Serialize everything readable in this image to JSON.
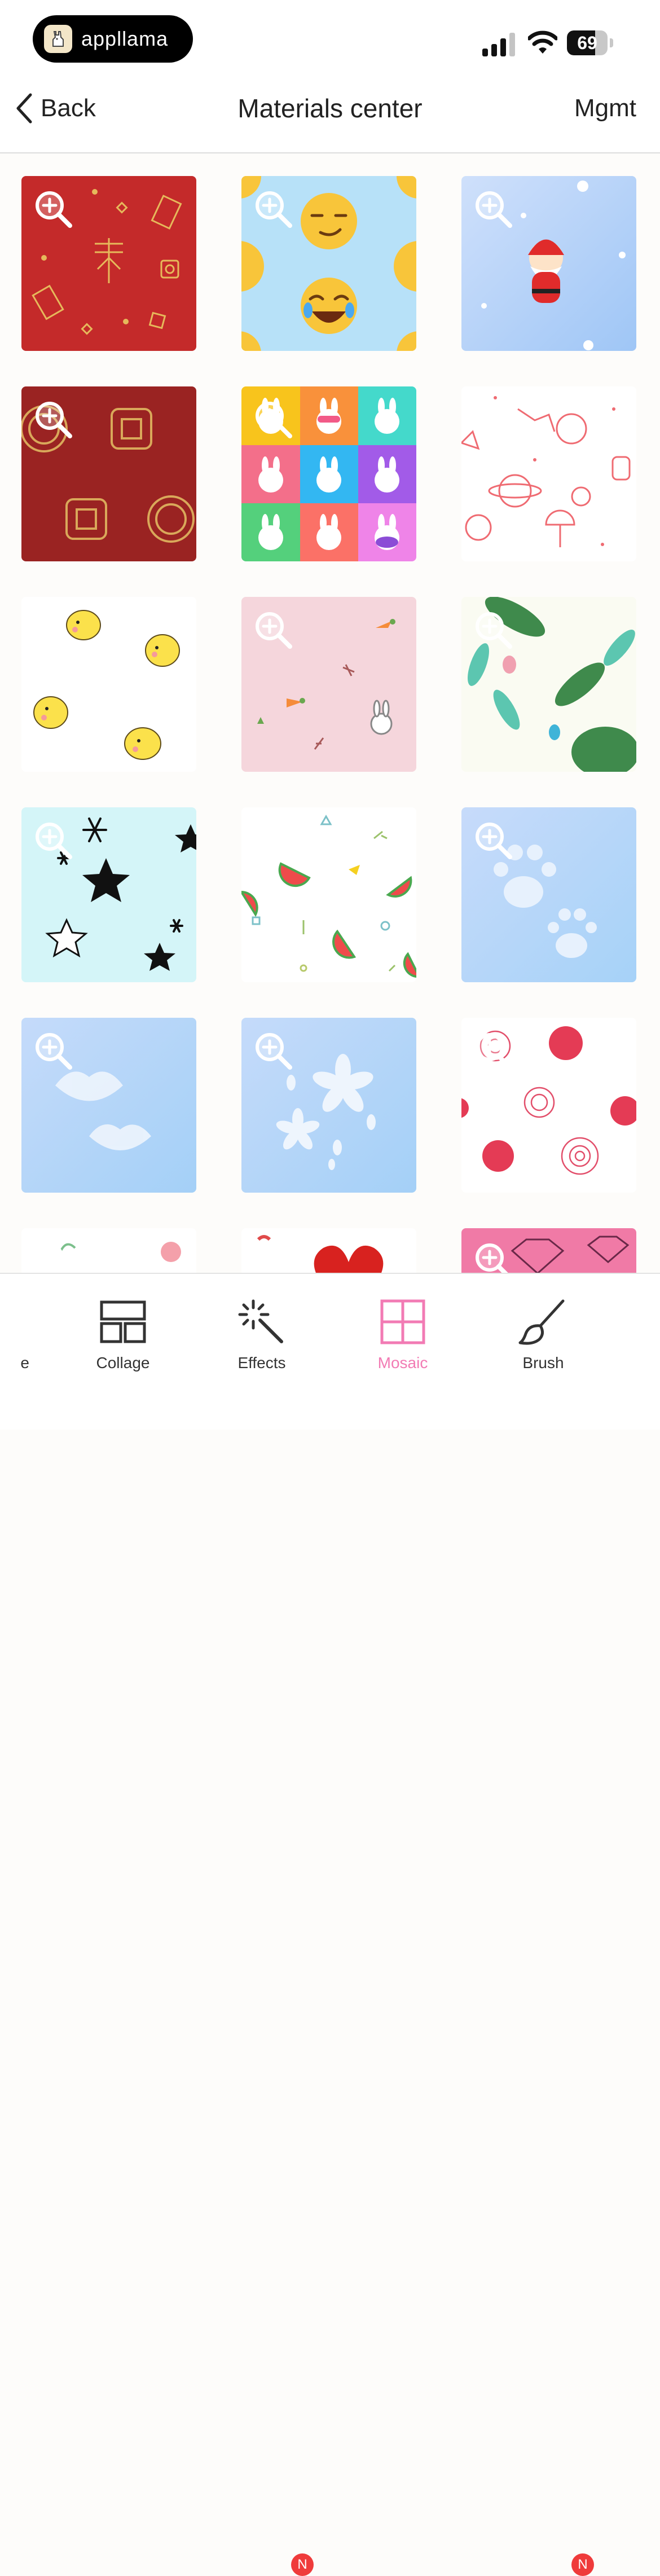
{
  "status_bar": {
    "app_name": "appllama",
    "battery_level": "69",
    "battery_fraction": 0.69
  },
  "nav": {
    "back_label": "Back",
    "title": "Materials center",
    "manage_label": "Mgmt"
  },
  "materials": [
    {
      "theme": "red-spring-festival"
    },
    {
      "theme": "emoji-faces"
    },
    {
      "theme": "santa-snow"
    },
    {
      "theme": "mooncake-red"
    },
    {
      "theme": "bunny-colorblocks"
    },
    {
      "theme": "space-line-doodles"
    },
    {
      "theme": "yellow-chicks"
    },
    {
      "theme": "pink-bunny-carrot"
    },
    {
      "theme": "tropical-leaves"
    },
    {
      "theme": "black-stars"
    },
    {
      "theme": "watermelon"
    },
    {
      "theme": "paw-prints"
    },
    {
      "theme": "lips-prints"
    },
    {
      "theme": "sakura-flowers"
    },
    {
      "theme": "red-roses"
    },
    {
      "theme": "pink-flowers"
    },
    {
      "theme": "red-heart"
    },
    {
      "theme": "diamonds-pink"
    }
  ],
  "tabbar": {
    "items": [
      {
        "label": "Collage"
      },
      {
        "label": "Effects",
        "badge": "N"
      },
      {
        "label": "Mosaic"
      },
      {
        "label": "Brush",
        "badge": "N"
      }
    ],
    "partial_label_tail": "e"
  },
  "colors": {
    "accent": "#f27bb4",
    "badge": "#ef3b3b"
  }
}
